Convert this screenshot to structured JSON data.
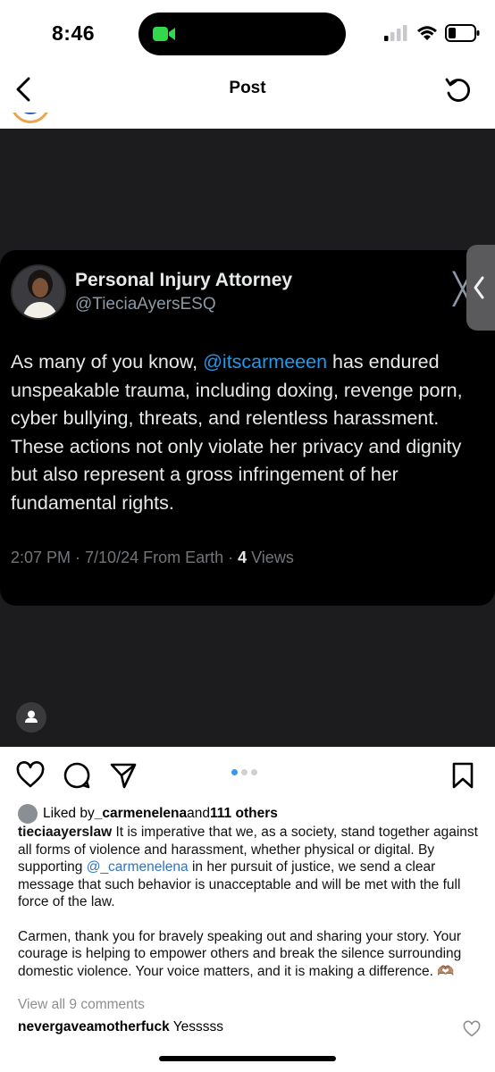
{
  "status_bar": {
    "time": "8:46"
  },
  "nav": {
    "title": "Post"
  },
  "tweet": {
    "name": "Personal Injury Attorney",
    "handle": "@TieciaAyersESQ",
    "body_prefix": "As many of you know, ",
    "mention": "@itscarmeeen",
    "body_suffix": " has endured unspeakable trauma, including doxing, revenge porn, cyber bullying, threats, and relentless harassment. These actions not only violate her privacy and dignity but also represent a gross infringement of her fundamental rights.",
    "meta_prefix": "2:07 PM · 7/10/24 From Earth · ",
    "views_count": "4",
    "views_label": " Views"
  },
  "carousel": {
    "total": 3,
    "active_index": 0
  },
  "likes": {
    "prefix": "Liked by ",
    "user": "_carmenelena",
    "middle": " and ",
    "others": "111 others"
  },
  "caption": {
    "username": "tieciaayerslaw",
    "text_before": " It is imperative that we, as a society, stand together against all forms of violence and harassment, whether physical or digital. By supporting ",
    "mention": "@_carmenelena",
    "text_after": " in her pursuit of justice, we send a clear message that such behavior is unacceptable and will be met with the full force of the law.",
    "paragraph2": "Carmen, thank you for bravely speaking out and sharing your story. Your courage is helping to empower others and break the silence surrounding domestic violence. Your voice matters, and it is making a difference. 🫶🏽"
  },
  "comments": {
    "view_all": "View all 9 comments",
    "items": [
      {
        "user": "nevergaveamotherfuck",
        "text": " Yesssss"
      }
    ]
  },
  "colors": {
    "accent_blue": "#1d9bf0",
    "carousel_active": "#3897f0",
    "facetime_green": "#32d74b"
  }
}
